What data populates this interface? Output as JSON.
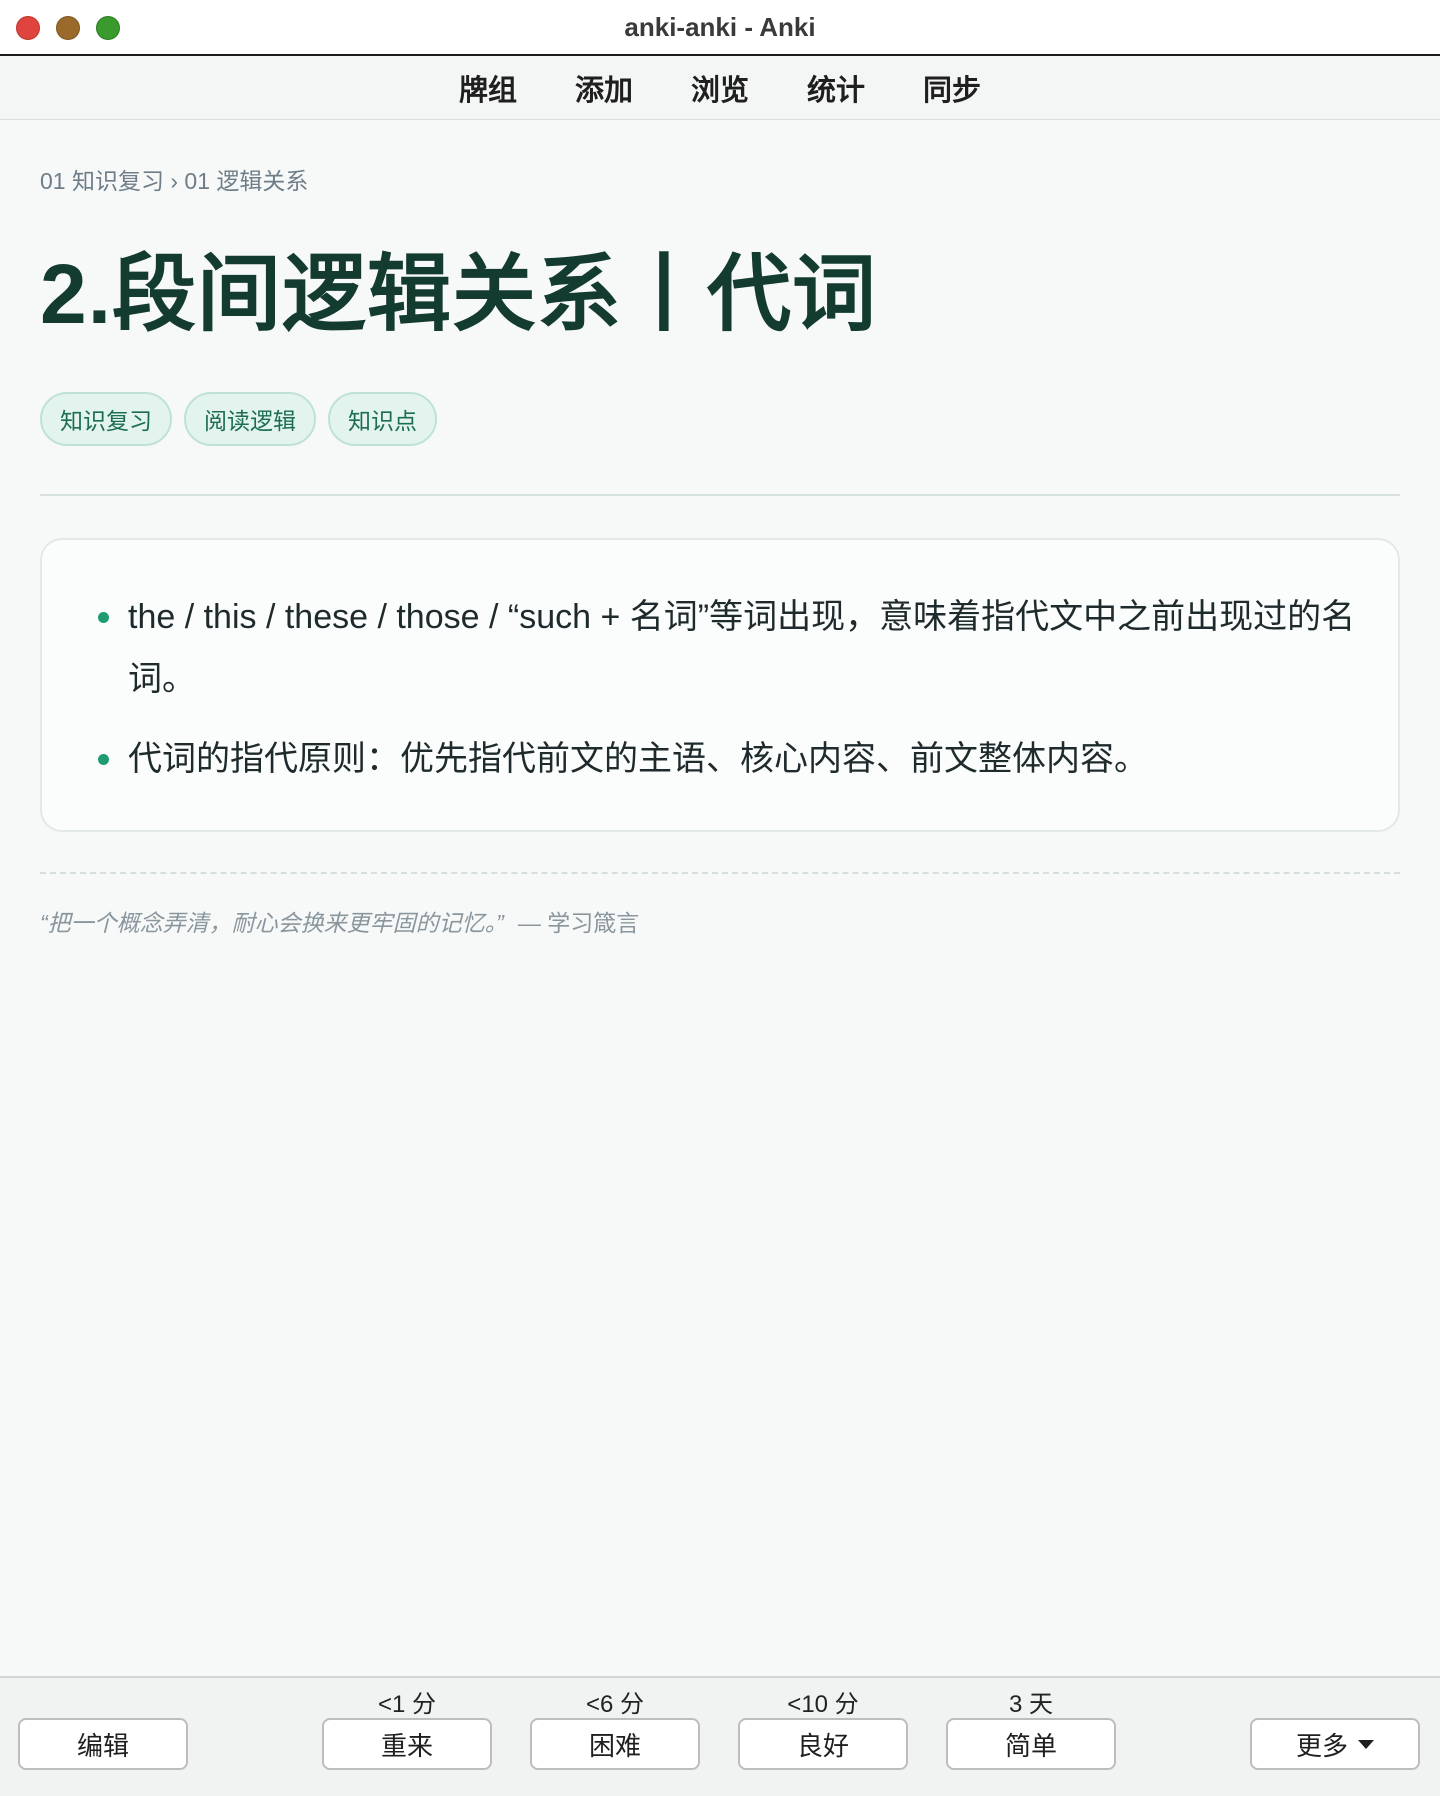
{
  "window": {
    "title": "anki-anki - Anki"
  },
  "menu": {
    "items": [
      "牌组",
      "添加",
      "浏览",
      "统计",
      "同步"
    ]
  },
  "card": {
    "breadcrumb": "01 知识复习 › 01 逻辑关系",
    "title": "2.段间逻辑关系丨代词",
    "tags": [
      "知识复习",
      "阅读逻辑",
      "知识点"
    ],
    "notes": [
      "the / this / these / those / “such + 名词”等词出现，意味着指代文中之前出现过的名词。",
      "代词的指代原则：优先指代前文的主语、核心内容、前文整体内容。"
    ],
    "quote": {
      "text": "“把一个概念弄清，耐心会换来更牢固的记忆。”",
      "source": "— 学习箴言"
    }
  },
  "answer_bar": {
    "edit_label": "编辑",
    "more_label": "更多",
    "buttons": [
      {
        "label": "重来",
        "interval": "<1 分"
      },
      {
        "label": "困难",
        "interval": "<6 分"
      },
      {
        "label": "良好",
        "interval": "<10 分"
      },
      {
        "label": "简单",
        "interval": "3 天"
      }
    ]
  }
}
